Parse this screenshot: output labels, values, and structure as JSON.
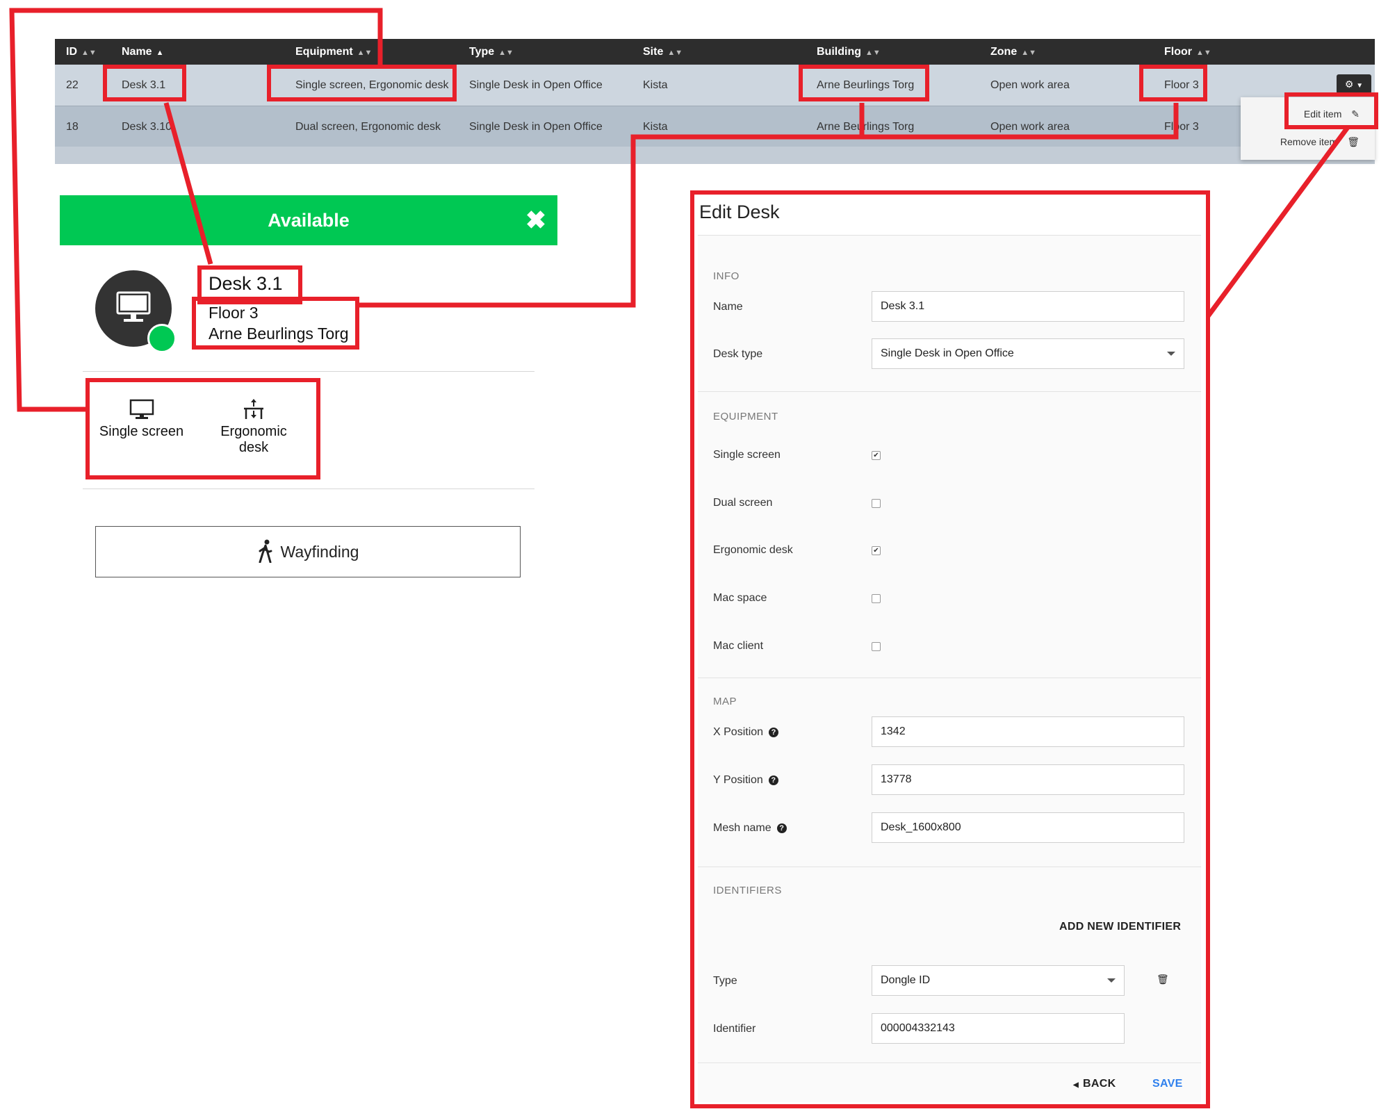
{
  "table": {
    "columns": [
      "ID",
      "Name",
      "Equipment",
      "Type",
      "Site",
      "Building",
      "Zone",
      "Floor"
    ],
    "rows": [
      {
        "id": "22",
        "name": "Desk 3.1",
        "equipment": "Single screen, Ergonomic desk",
        "type": "Single Desk in Open Office",
        "site": "Kista",
        "building": "Arne Beurlings Torg",
        "zone": "Open work area",
        "floor": "Floor 3"
      },
      {
        "id": "18",
        "name": "Desk 3.10",
        "equipment": "Dual screen, Ergonomic desk",
        "type": "Single Desk in Open Office",
        "site": "Kista",
        "building": "Arne Beurlings Torg",
        "zone": "Open work area",
        "floor": "Floor 3"
      }
    ],
    "row_menu": {
      "edit_label": "Edit item",
      "remove_label": "Remove item"
    }
  },
  "card": {
    "status": "Available",
    "name": "Desk 3.1",
    "floor": "Floor 3",
    "building": "Arne Beurlings Torg",
    "equipment": [
      {
        "label": "Single screen",
        "icon": "monitor-icon"
      },
      {
        "label": "Ergonomic desk",
        "icon": "desk-height-icon"
      }
    ],
    "wayfinding_label": "Wayfinding",
    "accent_color": "#00c853"
  },
  "edit": {
    "title": "Edit Desk",
    "info_section": "INFO",
    "name_label": "Name",
    "name_value": "Desk 3.1",
    "desk_type_label": "Desk type",
    "desk_type_value": "Single Desk in Open Office",
    "equipment_section": "EQUIPMENT",
    "equipment_options": [
      {
        "label": "Single screen",
        "checked": true
      },
      {
        "label": "Dual screen",
        "checked": false
      },
      {
        "label": "Ergonomic desk",
        "checked": true
      },
      {
        "label": "Mac space",
        "checked": false
      },
      {
        "label": "Mac client",
        "checked": false
      }
    ],
    "map_section": "MAP",
    "x_label": "X Position",
    "x_value": "1342",
    "y_label": "Y Position",
    "y_value": "13778",
    "mesh_label": "Mesh name",
    "mesh_value": "Desk_1600x800",
    "identifiers_section": "IDENTIFIERS",
    "add_identifier_label": "ADD NEW IDENTIFIER",
    "type_label": "Type",
    "type_value": "Dongle ID",
    "identifier_label": "Identifier",
    "identifier_value": "000004332143",
    "back_label": "BACK",
    "save_label": "SAVE",
    "save_color": "#2f80ed"
  },
  "annotation_color": "#e8202a"
}
